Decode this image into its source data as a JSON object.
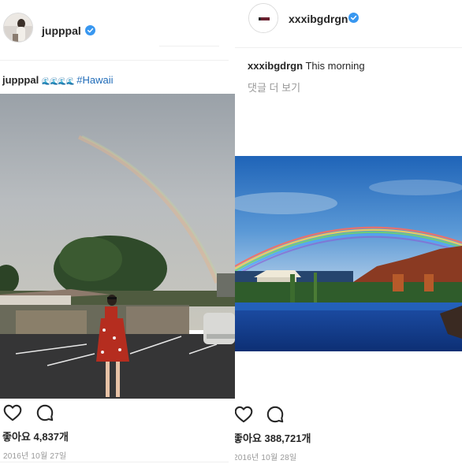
{
  "left_post": {
    "username": "jupppal",
    "caption_username": "jupppal",
    "caption_emoji": "🌊🌊🌊🌊",
    "caption_hashtag": "#Hawaii",
    "likes_text": "좋아요 4,837개",
    "date": "2016년 10월 27일",
    "icons": [
      "avatar",
      "verified-badge-icon",
      "heart-icon",
      "comment-icon"
    ]
  },
  "right_post": {
    "username": "xxxibgdrgn",
    "caption_username": "xxxibgdrgn",
    "caption_text": "This morning",
    "comments_link": "댓글 더 보기",
    "likes_text": "좋아요 388,721개",
    "date": "2016년 10월 28일",
    "icons": [
      "avatar",
      "verified-badge-icon",
      "heart-icon",
      "comment-icon"
    ]
  },
  "colors": {
    "verified": "#3897f0",
    "hashtag": "#1f6bb8",
    "text": "#262626",
    "muted": "#999999",
    "divider": "#efefef"
  }
}
